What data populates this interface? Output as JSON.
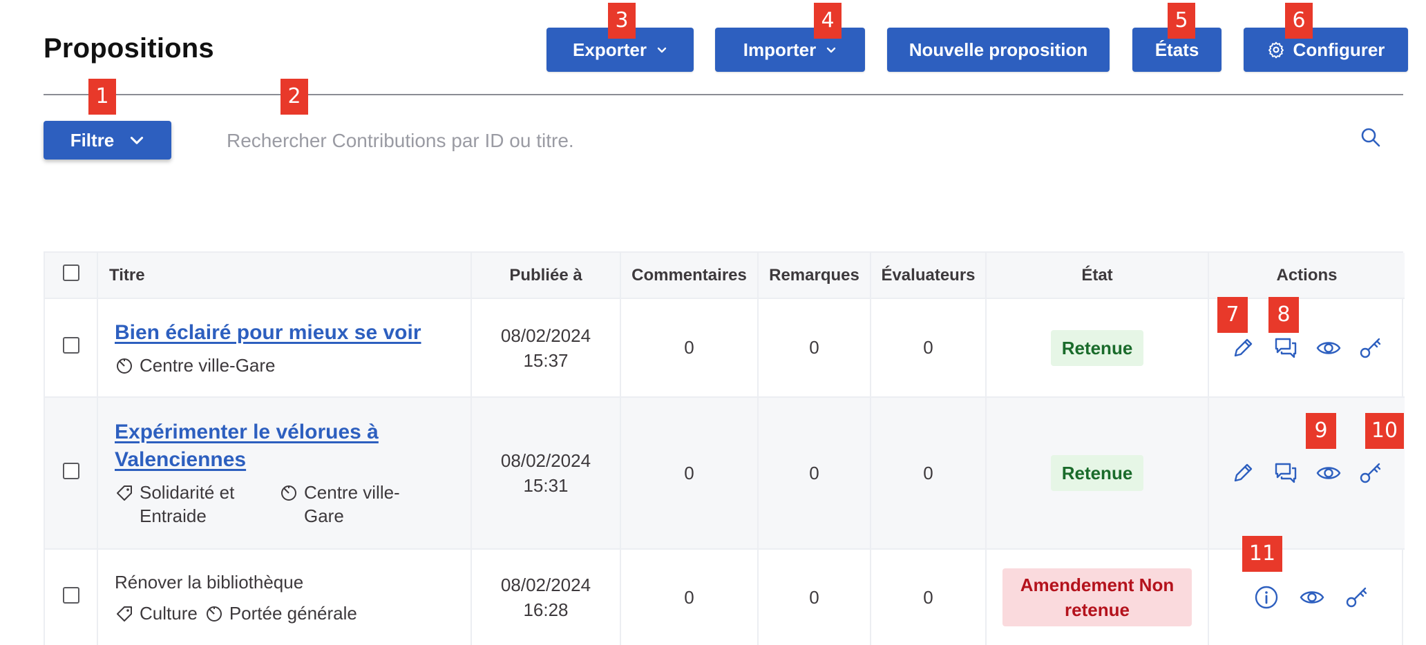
{
  "page": {
    "title": "Propositions"
  },
  "toolbar": {
    "export_label": "Exporter",
    "import_label": "Importer",
    "new_label": "Nouvelle proposition",
    "states_label": "États",
    "configure_label": "Configurer"
  },
  "filter": {
    "button_label": "Filtre",
    "search_placeholder": "Rechercher Contributions par ID ou titre."
  },
  "table": {
    "headers": {
      "title": "Titre",
      "published": "Publiée à",
      "comments": "Commentaires",
      "remarks": "Remarques",
      "evaluators": "Évaluateurs",
      "state": "État",
      "actions": "Actions"
    },
    "rows": [
      {
        "title": "Bien éclairé pour mieux se voir",
        "scope": "Centre ville-Gare",
        "date": "08/02/2024",
        "time": "15:37",
        "comments": "0",
        "remarks": "0",
        "evaluators": "0",
        "state": "Retenue"
      },
      {
        "title_line1": "Expérimenter le vélorues à",
        "title_line2": "Valenciennes",
        "category_line1": "Solidarité et",
        "category_line2": "Entraide",
        "scope_line1": "Centre ville-",
        "scope_line2": "Gare",
        "date": "08/02/2024",
        "time": "15:31",
        "comments": "0",
        "remarks": "0",
        "evaluators": "0",
        "state": "Retenue"
      },
      {
        "title": "Rénover la bibliothèque",
        "category": "Culture",
        "scope": "Portée générale",
        "date": "08/02/2024",
        "time": "16:28",
        "comments": "0",
        "remarks": "0",
        "evaluators": "0",
        "state_line1": "Amendement Non",
        "state_line2": "retenue"
      }
    ]
  },
  "markers": [
    "1",
    "2",
    "3",
    "4",
    "5",
    "6",
    "7",
    "8",
    "9",
    "10",
    "11"
  ],
  "colors": {
    "primary": "#2d5fbf",
    "marker": "#e8392a",
    "accepted_bg": "#e6f6e6",
    "accepted_text": "#1a6b2b",
    "rejected_bg": "#fadadd",
    "rejected_text": "#b4121c"
  },
  "icons": [
    "chevron-down-icon",
    "gear-icon",
    "search-icon",
    "pencil-icon",
    "comments-icon",
    "eye-icon",
    "key-icon",
    "info-icon",
    "tag-icon",
    "scope-icon"
  ]
}
